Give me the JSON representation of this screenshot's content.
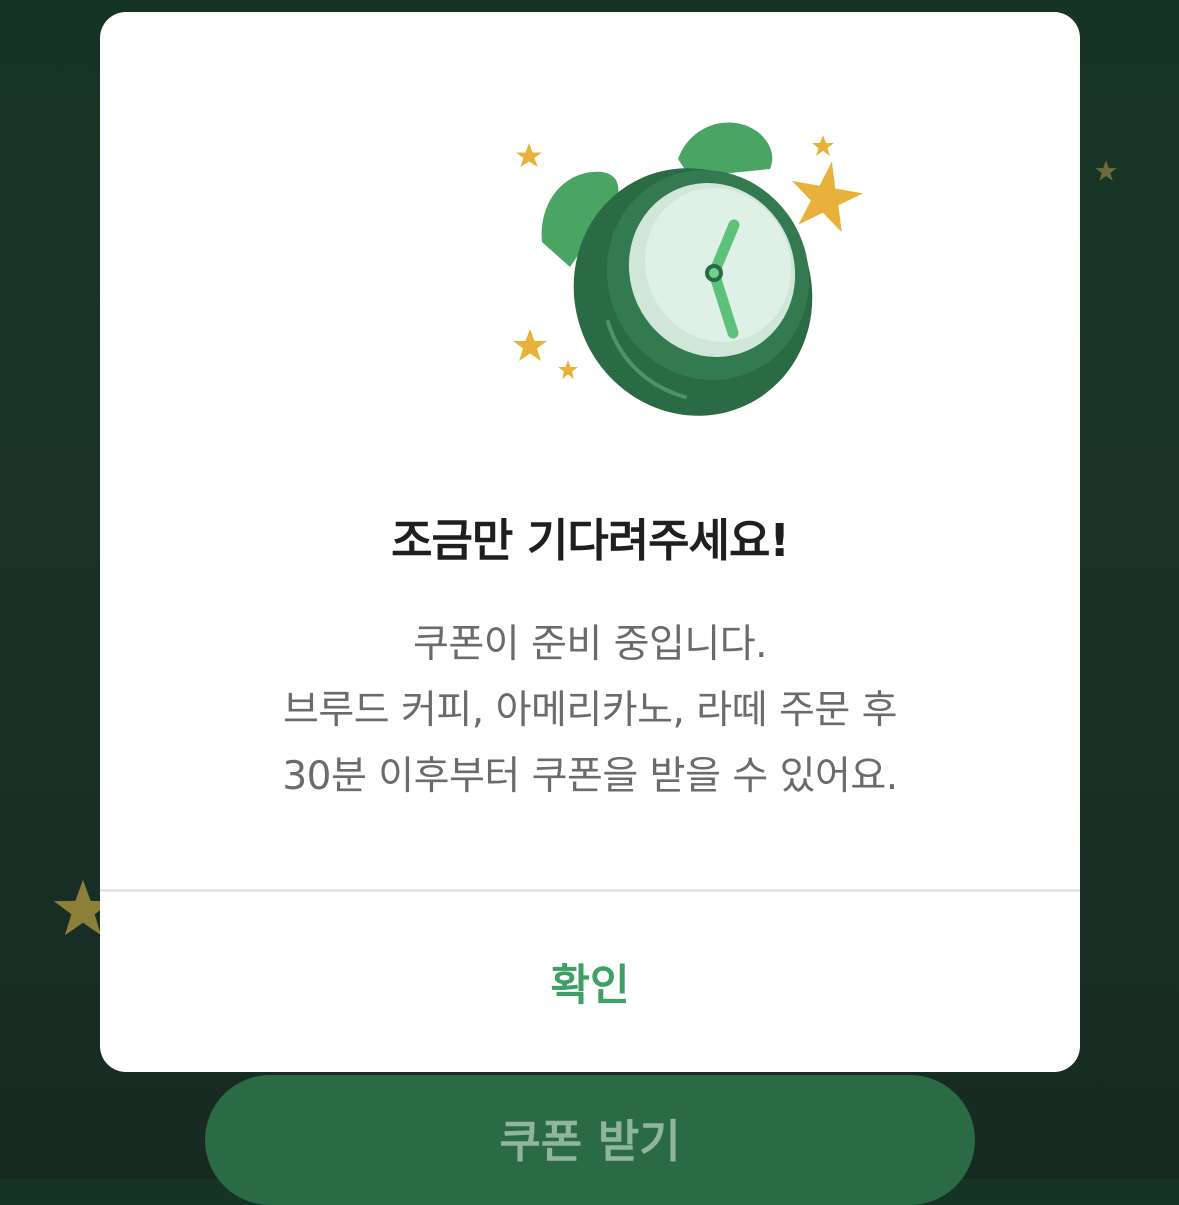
{
  "dialog": {
    "title": "조금만 기다려주세요!",
    "message_lines": [
      "쿠폰이 준비 중입니다.",
      "브루드 커피, 아메리카노, 라떼 주문 후",
      "30분 이후부터 쿠폰을 받을 수 있어요."
    ],
    "confirm_label": "확인",
    "illustration_icon": "alarm-clock-icon"
  },
  "background": {
    "coupon_button_label": "쿠폰 받기"
  },
  "colors": {
    "accent": "#3fa063",
    "background": "#163425",
    "coupon_button": "#2a6a44",
    "star": "#e8b23a"
  }
}
